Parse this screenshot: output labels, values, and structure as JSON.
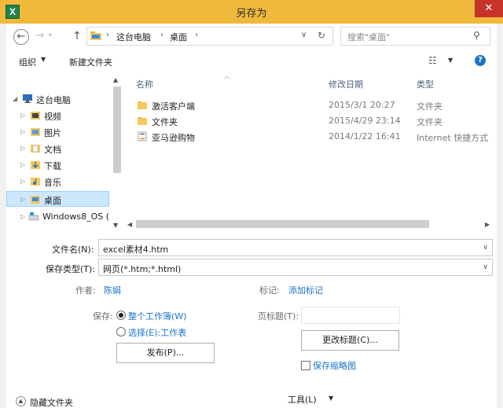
{
  "window": {
    "title": "另存为",
    "app_icon": "X",
    "close_label": "✕"
  },
  "address": {
    "crumbs": [
      "这台电脑",
      "桌面"
    ],
    "search_placeholder": "搜索\"桌面\""
  },
  "toolbar": {
    "organize": "组织",
    "new_folder": "新建文件夹"
  },
  "tree": {
    "items": [
      {
        "label": "这台电脑",
        "icon": "computer-icon"
      },
      {
        "label": "视频",
        "icon": "video-folder-icon"
      },
      {
        "label": "图片",
        "icon": "pictures-folder-icon"
      },
      {
        "label": "文档",
        "icon": "documents-folder-icon"
      },
      {
        "label": "下载",
        "icon": "downloads-folder-icon"
      },
      {
        "label": "音乐",
        "icon": "music-folder-icon"
      },
      {
        "label": "桌面",
        "icon": "desktop-folder-icon"
      },
      {
        "label": "Windows8_OS (",
        "icon": "drive-icon"
      }
    ]
  },
  "file_list": {
    "columns": {
      "name": "名称",
      "date": "修改日期",
      "type": "类型"
    },
    "rows": [
      {
        "name": "激活客户端",
        "date": "2015/3/1 20:27",
        "type": "文件夹",
        "icon": "folder-icon"
      },
      {
        "name": "文件夹",
        "date": "2015/4/29 23:14",
        "type": "文件夹",
        "icon": "folder-icon"
      },
      {
        "name": "亚马逊购物",
        "date": "2014/1/22 16:41",
        "type": "Internet 快捷方式",
        "icon": "internet-shortcut-icon"
      }
    ]
  },
  "form": {
    "filename_label": "文件名(N):",
    "filename_value": "excel素材4.htm",
    "filetype_label": "保存类型(T):",
    "filetype_value": "网页(*.htm;*.html)",
    "author_label": "作者:",
    "author_value": "陈娟",
    "tags_label": "标记:",
    "tags_value": "添加标记",
    "save_label": "保存:",
    "radio_workbook": "整个工作簿(W)",
    "radio_selection": "选择(E):工作表",
    "publish_button": "发布(P)...",
    "page_title_label": "页标题(T):",
    "change_title_button": "更改标题(C)...",
    "save_thumbnail": "保存缩略图",
    "hide_folders": "隐藏文件夹",
    "tools": "工具(L)"
  },
  "colors": {
    "accent": "#1a74c8",
    "titlebar": "#f0b93c",
    "close": "#c7332a",
    "selection": "#cce8ff"
  }
}
